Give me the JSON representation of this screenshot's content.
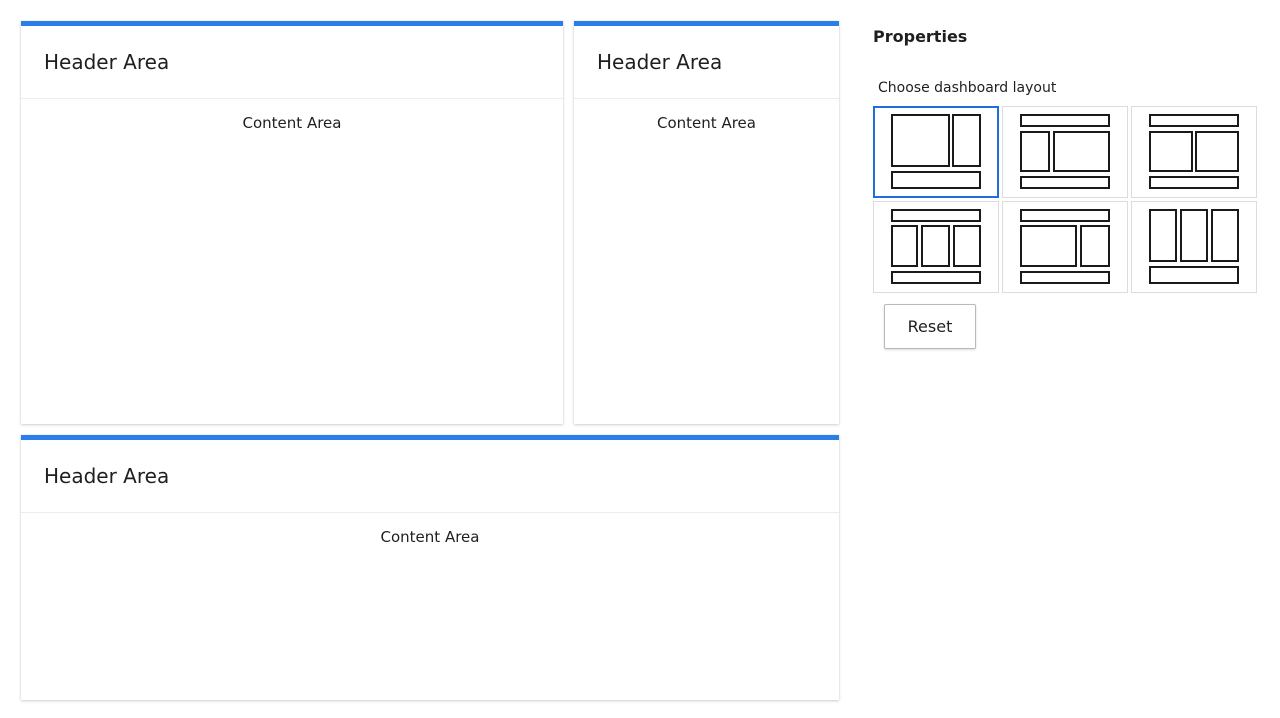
{
  "panels": [
    {
      "header": "Header Area",
      "content": "Content Area"
    },
    {
      "header": "Header Area",
      "content": "Content Area"
    },
    {
      "header": "Header Area",
      "content": "Content Area"
    }
  ],
  "properties": {
    "title": "Properties",
    "layout_label": "Choose dashboard layout",
    "selected_layout": 1,
    "layout_count": 6,
    "reset_label": "Reset"
  },
  "colors": {
    "accent": "#2b7de9",
    "selected_border": "#1e6fd9"
  }
}
